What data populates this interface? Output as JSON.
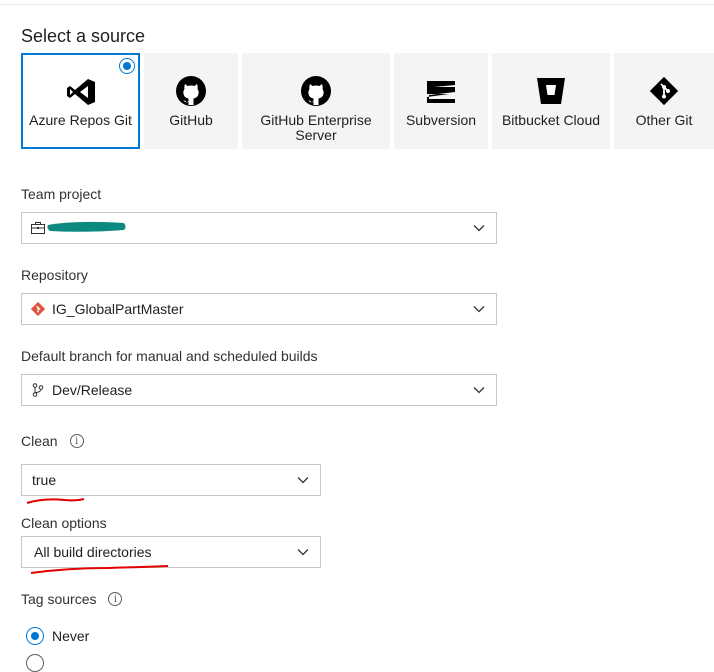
{
  "page": {
    "title": "Select a source"
  },
  "sources": [
    {
      "label": "Azure Repos Git",
      "icon": "azure-repos-icon",
      "selected": true
    },
    {
      "label": "GitHub",
      "icon": "github-icon",
      "selected": false
    },
    {
      "label": "GitHub Enterprise Server",
      "label_line1": "GitHub Enterprise",
      "label_line2": "Server",
      "icon": "github-icon",
      "selected": false
    },
    {
      "label": "Subversion",
      "icon": "subversion-icon",
      "selected": false
    },
    {
      "label": "Bitbucket Cloud",
      "icon": "bitbucket-icon",
      "selected": false
    },
    {
      "label": "Other Git",
      "icon": "git-icon",
      "selected": false
    }
  ],
  "team_project": {
    "label": "Team project",
    "value": ""
  },
  "repository": {
    "label": "Repository",
    "value": "IG_GlobalPartMaster"
  },
  "default_branch": {
    "label": "Default branch for manual and scheduled builds",
    "value": "Dev/Release"
  },
  "clean": {
    "label": "Clean",
    "value": "true"
  },
  "clean_options": {
    "label": "Clean options",
    "value": "All build directories"
  },
  "tag_sources": {
    "label": "Tag sources",
    "options": [
      {
        "label": "Never",
        "selected": true
      }
    ]
  },
  "colors": {
    "accent": "#0078d4",
    "annotation": "#e00000",
    "redaction": "#0c8a80",
    "git": "#e0543e"
  }
}
